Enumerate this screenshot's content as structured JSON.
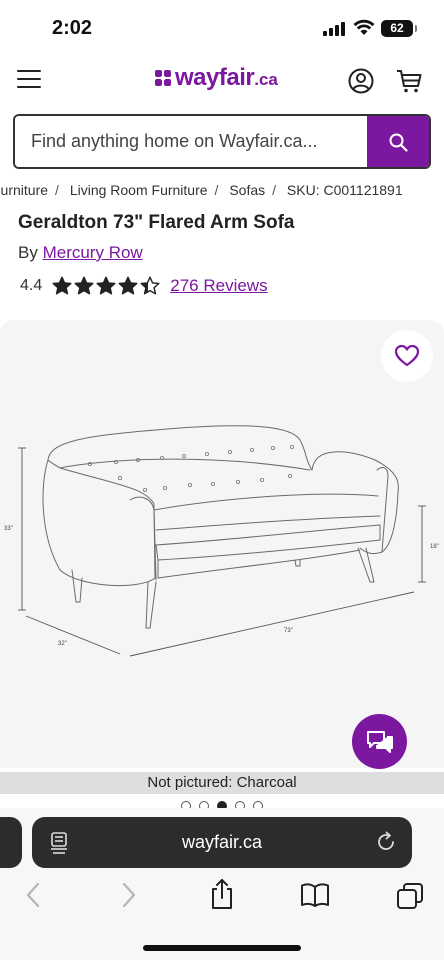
{
  "status_bar": {
    "time": "2:02",
    "battery": "62"
  },
  "header": {
    "logo_word": "wayfair",
    "logo_tld": ".ca",
    "brand_color": "#7B189F"
  },
  "search": {
    "placeholder": "Find anything home on Wayfair.ca..."
  },
  "breadcrumb": [
    "Furniture",
    "Living Room Furniture",
    "Sofas",
    "SKU: C001121891"
  ],
  "product": {
    "title": "Geraldton 73\" Flared Arm Sofa",
    "by_label": "By",
    "brand": "Mercury Row",
    "rating_value": "4.4",
    "rating_stars": 4.4,
    "reviews_label": "276 Reviews"
  },
  "diagram": {
    "height": "33\"",
    "depth": "32\"",
    "width": "73\"",
    "seat_height": "18\""
  },
  "gallery": {
    "caption": "Not pictured: Charcoal",
    "dot_count": 5,
    "active_dot": 2
  },
  "browser": {
    "url": "wayfair.ca"
  },
  "icons": {
    "menu": "hamburger-icon",
    "account": "account-icon",
    "cart": "cart-icon",
    "search": "search-icon",
    "favorite": "heart-icon",
    "chat": "chat-icon",
    "reload": "reload-icon",
    "back": "back-icon",
    "forward": "forward-icon",
    "share": "share-icon",
    "bookmarks": "bookmarks-icon",
    "tabs": "tabs-icon"
  }
}
